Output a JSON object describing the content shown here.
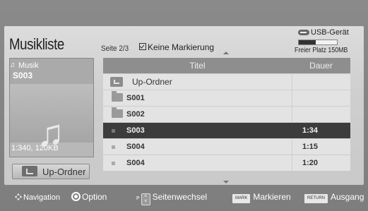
{
  "header": {
    "title": "Musikliste",
    "page_info": "Seite 2/3",
    "mark_status": "Keine Markierung"
  },
  "usb": {
    "device_label": "USB-Gerät",
    "free_space": "Freier Platz 150MB",
    "used_fraction": 0.45
  },
  "now_playing": {
    "category": "Musik",
    "file_name": "S003",
    "info": "1:340, 120KB"
  },
  "up_folder_button": {
    "label": "Up-Ordner"
  },
  "file_list": {
    "columns": [
      "Titel",
      "Dauer"
    ],
    "up_row_label": "Up-Ordner",
    "rows": [
      {
        "name": "S001",
        "duration": "",
        "type": "folder"
      },
      {
        "name": "S002",
        "duration": "",
        "type": "folder"
      },
      {
        "name": "S003",
        "duration": "1:34",
        "type": "file",
        "selected": true
      },
      {
        "name": "S004",
        "duration": "1:15",
        "type": "file"
      },
      {
        "name": "S004",
        "duration": "1:20",
        "type": "file"
      }
    ]
  },
  "footer": {
    "navigation": "Navigation",
    "option": "Option",
    "page_prefix": "P",
    "page_change": "Seitenwechsel",
    "mark_key": "MARK",
    "mark_label": "Markieren",
    "return_key": "RETURN",
    "return_label": "Ausgang"
  }
}
